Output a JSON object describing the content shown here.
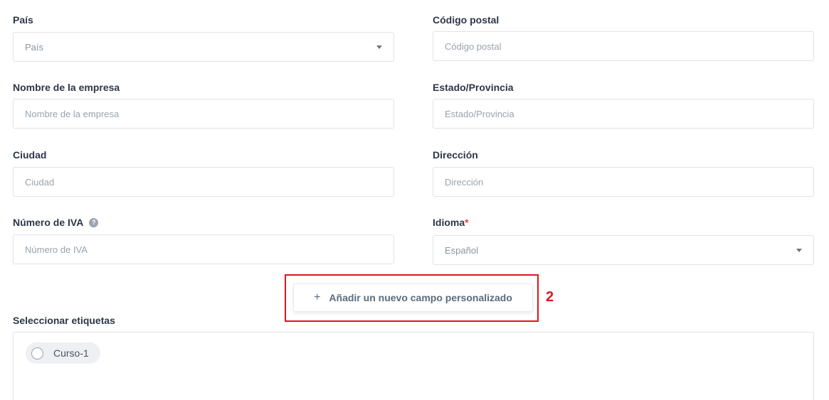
{
  "form": {
    "country": {
      "label": "País",
      "value": "País"
    },
    "postal_code": {
      "label": "Código postal",
      "placeholder": "Código postal"
    },
    "company_name": {
      "label": "Nombre de la empresa",
      "placeholder": "Nombre de la empresa"
    },
    "state": {
      "label": "Estado/Provincia",
      "placeholder": "Estado/Provincia"
    },
    "city": {
      "label": "Ciudad",
      "placeholder": "Ciudad"
    },
    "address": {
      "label": "Dirección",
      "placeholder": "Dirección"
    },
    "vat": {
      "label": "Número de IVA",
      "placeholder": "Número de IVA",
      "help_icon": "question-circle-icon"
    },
    "language": {
      "label": "Idioma",
      "required_mark": "*",
      "value": "Español"
    }
  },
  "add_custom_field": {
    "icon": "plus-icon",
    "plus_glyph": "+",
    "label": "Añadir un nuevo campo personalizado"
  },
  "annotation": {
    "number": "2",
    "color": "#e0141c"
  },
  "tags": {
    "label": "Seleccionar etiquetas",
    "items": [
      {
        "label": "Curso-1"
      }
    ]
  }
}
